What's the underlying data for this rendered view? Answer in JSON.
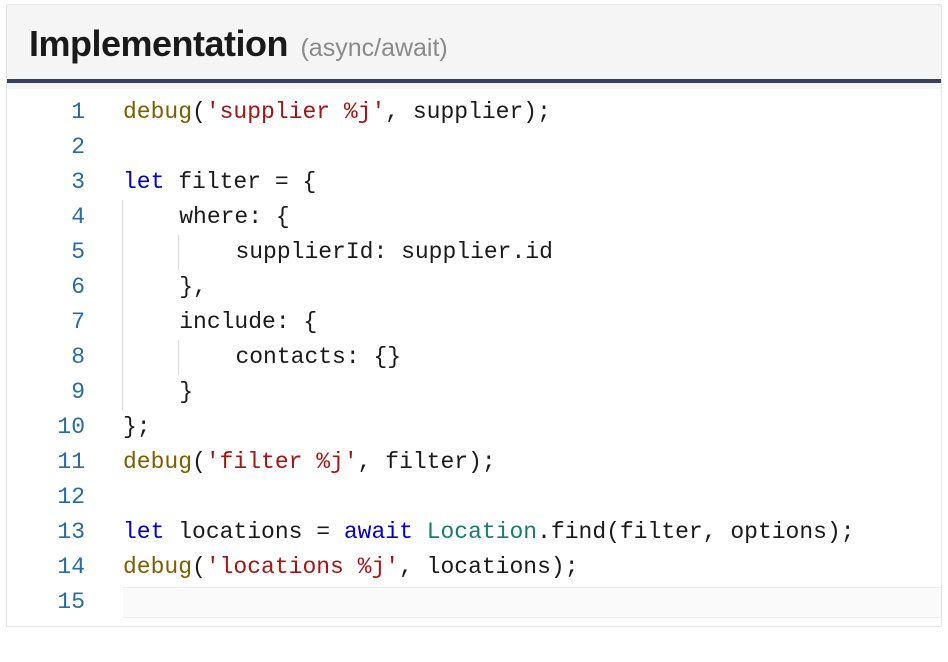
{
  "header": {
    "title": "Implementation",
    "subtitle": "(async/await)"
  },
  "code": {
    "lines": [
      {
        "n": "1",
        "segs": [
          {
            "t": "debug",
            "c": "fn"
          },
          {
            "t": "(",
            "c": "pl"
          },
          {
            "t": "'supplier %j'",
            "c": "str"
          },
          {
            "t": ", supplier);",
            "c": "pl"
          }
        ]
      },
      {
        "n": "2",
        "segs": []
      },
      {
        "n": "3",
        "segs": [
          {
            "t": "let",
            "c": "kw"
          },
          {
            "t": " filter = {",
            "c": "pl"
          }
        ]
      },
      {
        "n": "4",
        "segs": [
          {
            "t": "    ",
            "c": "pl",
            "guide": true
          },
          {
            "t": "where: {",
            "c": "pl"
          }
        ]
      },
      {
        "n": "5",
        "segs": [
          {
            "t": "    ",
            "c": "pl",
            "guide": true
          },
          {
            "t": "    ",
            "c": "pl",
            "guide": true
          },
          {
            "t": "supplierId: supplier.id",
            "c": "pl"
          }
        ]
      },
      {
        "n": "6",
        "segs": [
          {
            "t": "    ",
            "c": "pl",
            "guide": true
          },
          {
            "t": "},",
            "c": "pl"
          }
        ]
      },
      {
        "n": "7",
        "segs": [
          {
            "t": "    ",
            "c": "pl",
            "guide": true
          },
          {
            "t": "include: {",
            "c": "pl"
          }
        ]
      },
      {
        "n": "8",
        "segs": [
          {
            "t": "    ",
            "c": "pl",
            "guide": true
          },
          {
            "t": "    ",
            "c": "pl",
            "guide": true
          },
          {
            "t": "contacts: {}",
            "c": "pl"
          }
        ]
      },
      {
        "n": "9",
        "segs": [
          {
            "t": "    ",
            "c": "pl",
            "guide": true
          },
          {
            "t": "}",
            "c": "pl"
          }
        ]
      },
      {
        "n": "10",
        "segs": [
          {
            "t": "};",
            "c": "pl"
          }
        ]
      },
      {
        "n": "11",
        "segs": [
          {
            "t": "debug",
            "c": "fn"
          },
          {
            "t": "(",
            "c": "pl"
          },
          {
            "t": "'filter %j'",
            "c": "str"
          },
          {
            "t": ", filter);",
            "c": "pl"
          }
        ]
      },
      {
        "n": "12",
        "segs": []
      },
      {
        "n": "13",
        "segs": [
          {
            "t": "let",
            "c": "kw"
          },
          {
            "t": " locations = ",
            "c": "pl"
          },
          {
            "t": "await",
            "c": "kw"
          },
          {
            "t": " ",
            "c": "pl"
          },
          {
            "t": "Location",
            "c": "cls"
          },
          {
            "t": ".find(filter, options);",
            "c": "pl"
          }
        ]
      },
      {
        "n": "14",
        "segs": [
          {
            "t": "debug",
            "c": "fn"
          },
          {
            "t": "(",
            "c": "pl"
          },
          {
            "t": "'locations %j'",
            "c": "str"
          },
          {
            "t": ", locations);",
            "c": "pl"
          }
        ]
      },
      {
        "n": "15",
        "segs": [],
        "cursor": true
      }
    ]
  }
}
